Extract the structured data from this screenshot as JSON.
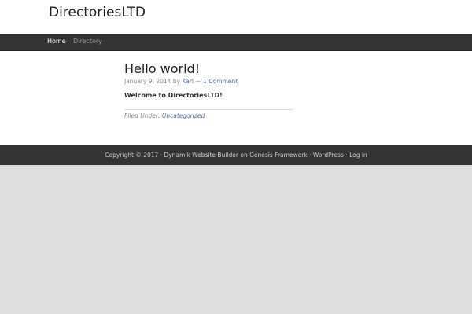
{
  "site_title": "DirectoriesLTD",
  "nav": {
    "home": "Home",
    "directory": "Directory"
  },
  "post": {
    "title": "Hello world!",
    "date": "January 9, 2014",
    "by": "by",
    "author": "Karl",
    "dash": "—",
    "comments": "1 Comment",
    "body": "Welcome to DirectoriesLTD!",
    "filed_under": "Filed Under:",
    "category": "Uncategorized"
  },
  "footer": {
    "copyright": "Copyright © 2017 ·",
    "builder": "Dynamik Website Builder",
    "on": "on",
    "genesis": "Genesis Framework",
    "sep": "·",
    "wordpress": "WordPress",
    "login": "Log in"
  }
}
